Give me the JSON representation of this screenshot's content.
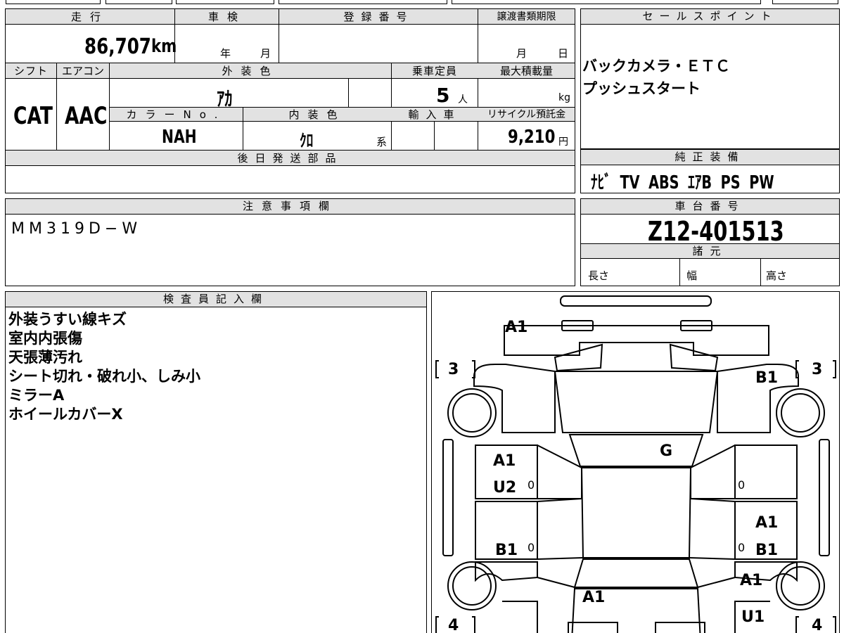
{
  "vehicle": {
    "labels": {
      "mileage": "走行",
      "inspection": "車検",
      "registration": "登録番号",
      "transfer_deadline": "譲渡書類期限",
      "shift": "シフト",
      "aircon": "エアコン",
      "exterior_color": "外装色",
      "capacity": "乗車定員",
      "max_load": "最大積載量",
      "color_no": "カラーNo.",
      "interior_color": "内装色",
      "import": "輸入車",
      "recycle_fee": "リサイクル預託金",
      "later_parts": "後日発送部品",
      "notes": "注意事項欄"
    },
    "mileage": "86,707",
    "mileage_unit": "km",
    "inspection_year": "年",
    "inspection_month": "月",
    "transfer_month": "月",
    "transfer_day": "日",
    "shift": "CAT",
    "aircon": "AAC",
    "exterior_color": "ｱｶ",
    "capacity": "5",
    "capacity_unit": "人",
    "max_load_unit": "kg",
    "color_no": "NAH",
    "interior_color": "ｸﾛ",
    "interior_suffix": "系",
    "recycle_fee": "9,210",
    "recycle_unit": "円",
    "notes": "MM319D−W"
  },
  "sales": {
    "header": "セールスポイント",
    "lines": [
      "バックカメラ・ＥＴＣ",
      "プッシュスタート"
    ]
  },
  "equipment": {
    "header": "純正装備",
    "text": "ﾅﾋﾞ TV ABS ｴｱB PS PW"
  },
  "chassis": {
    "header": "車台番号",
    "number": "Z12-401513",
    "specs_header": "諸元",
    "length": "長さ",
    "width": "幅",
    "height": "高さ"
  },
  "inspector": {
    "header": "検査員記入欄",
    "lines": [
      "外装うすい線キズ",
      "室内内張傷",
      "天張薄汚れ",
      "シート切れ・破れ小、しみ小",
      "ミラーA",
      "ホイールカバーX"
    ]
  },
  "diagram": {
    "marks": {
      "front": "A1",
      "right_front_fender": "B1",
      "roof": "G",
      "left_front_door_1": "A1",
      "left_front_door_2": "U2",
      "left_rear_door": "B1",
      "right_rear_door_1": "A1",
      "right_rear_door_2": "B1",
      "right_rear_quarter": "A1",
      "right_rear_bottom": "U1",
      "rear": "A1"
    },
    "tires": {
      "front_left": "3",
      "front_right": "3",
      "rear_left": "4",
      "rear_right": "4"
    },
    "small_mark": "0"
  }
}
